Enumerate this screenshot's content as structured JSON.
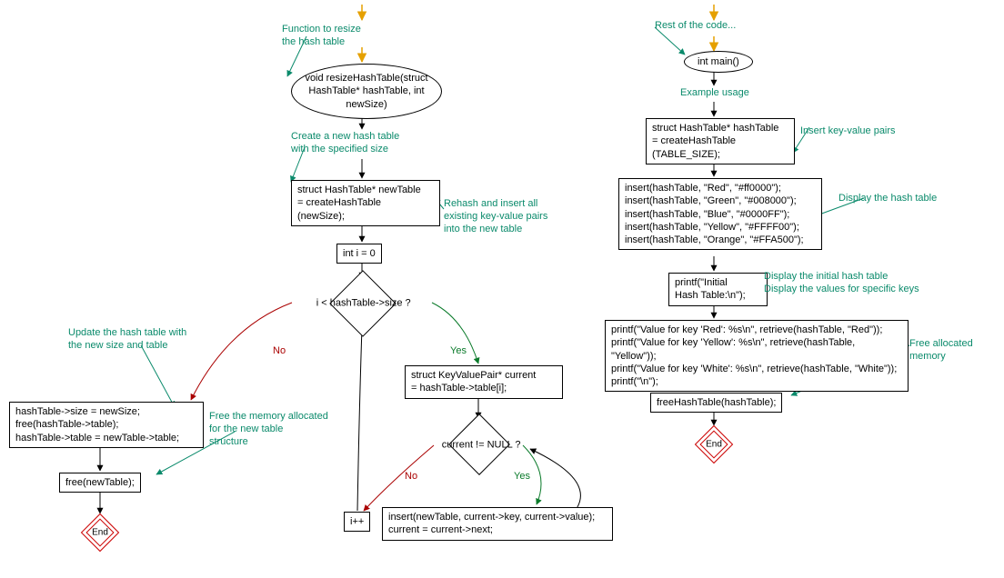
{
  "left": {
    "comment_top": "Function to resize\nthe hash table",
    "n_start": "void resizeHashTable(struct\nHashTable* hashTable, int\nnewSize)",
    "comment_create": "Create a new hash table\nwith the specified size",
    "n_create": "struct HashTable* newTable\n= createHashTable\n(newSize);",
    "comment_rehash": "Rehash and insert all\nexisting key-value pairs\ninto the new table",
    "n_init_i": "int i = 0",
    "n_cond_i": "i < hashTable->size ?",
    "no": "No",
    "yes": "Yes",
    "comment_update": "Update the hash table with\nthe new size and table",
    "n_update": "hashTable->size = newSize;\nfree(hashTable->table);\nhashTable->table = newTable->table;",
    "comment_free": "Free the memory allocated\nfor the new table\nstructure",
    "n_free": "free(newTable);",
    "end": "End",
    "n_current": "struct KeyValuePair* current\n= hashTable->table[i];",
    "n_cond_c": "current != NULL ?",
    "n_insert": "insert(newTable, current->key, current->value);\ncurrent = current->next;",
    "n_incr": "i++"
  },
  "right": {
    "comment_rest": "Rest of the code...",
    "n_main": "int main()",
    "comment_example": "Example usage",
    "n_create": "struct HashTable* hashTable\n= createHashTable\n(TABLE_SIZE);",
    "comment_insert": "Insert key-value pairs",
    "n_insert": "insert(hashTable, \"Red\", \"#ff0000\");\ninsert(hashTable, \"Green\", \"#008000\");\ninsert(hashTable, \"Blue\", \"#0000FF\");\ninsert(hashTable, \"Yellow\", \"#FFFF00\");\ninsert(hashTable, \"Orange\", \"#FFA500\");",
    "comment_display": "Display the hash table",
    "n_print_init": "printf(\"Initial\nHash Table:\\n\");",
    "comment_display_init": "Display the initial hash table",
    "comment_display_vals": "Display the values for specific keys",
    "n_print_vals": "printf(\"Value for key 'Red': %s\\n\", retrieve(hashTable, \"Red\"));\nprintf(\"Value for key 'Yellow': %s\\n\", retrieve(hashTable, \"Yellow\"));\nprintf(\"Value for key 'White': %s\\n\", retrieve(hashTable, \"White\"));\nprintf(\"\\n\");",
    "comment_free": "Free allocated memory",
    "n_free": "freeHashTable(hashTable);",
    "end": "End"
  },
  "chart_data": {
    "type": "flowchart",
    "flowcharts": [
      {
        "name": "resizeHashTable",
        "nodes": [
          {
            "id": "L1",
            "type": "start",
            "text": "void resizeHashTable(struct HashTable* hashTable, int newSize)",
            "comment": "Function to resize the hash table"
          },
          {
            "id": "L2",
            "type": "process",
            "text": "struct HashTable* newTable = createHashTable(newSize);",
            "comment": "Create a new hash table with the specified size"
          },
          {
            "id": "L3",
            "type": "process",
            "text": "int i = 0",
            "comment": "Rehash and insert all existing key-value pairs into the new table"
          },
          {
            "id": "L4",
            "type": "decision",
            "text": "i < hashTable->size ?"
          },
          {
            "id": "L5",
            "type": "process",
            "text": "struct KeyValuePair* current = hashTable->table[i];"
          },
          {
            "id": "L6",
            "type": "decision",
            "text": "current != NULL ?"
          },
          {
            "id": "L7",
            "type": "process",
            "text": "insert(newTable, current->key, current->value); current = current->next;"
          },
          {
            "id": "L8",
            "type": "process",
            "text": "i++"
          },
          {
            "id": "L9",
            "type": "process",
            "text": "hashTable->size = newSize; free(hashTable->table); hashTable->table = newTable->table;",
            "comment": "Update the hash table with the new size and table"
          },
          {
            "id": "L10",
            "type": "process",
            "text": "free(newTable);",
            "comment": "Free the memory allocated for the new table structure"
          },
          {
            "id": "L11",
            "type": "end",
            "text": "End"
          }
        ],
        "edges": [
          {
            "from": "L1",
            "to": "L2"
          },
          {
            "from": "L2",
            "to": "L3"
          },
          {
            "from": "L3",
            "to": "L4"
          },
          {
            "from": "L4",
            "to": "L5",
            "label": "Yes"
          },
          {
            "from": "L4",
            "to": "L9",
            "label": "No"
          },
          {
            "from": "L5",
            "to": "L6"
          },
          {
            "from": "L6",
            "to": "L7",
            "label": "Yes"
          },
          {
            "from": "L7",
            "to": "L6"
          },
          {
            "from": "L6",
            "to": "L8",
            "label": "No"
          },
          {
            "from": "L8",
            "to": "L4"
          },
          {
            "from": "L9",
            "to": "L10"
          },
          {
            "from": "L10",
            "to": "L11"
          }
        ]
      },
      {
        "name": "main",
        "nodes": [
          {
            "id": "R1",
            "type": "start",
            "text": "int main()",
            "comment": "Rest of the code..."
          },
          {
            "id": "R2",
            "type": "process",
            "text": "struct HashTable* hashTable = createHashTable(TABLE_SIZE);",
            "comment": "Example usage / Insert key-value pairs"
          },
          {
            "id": "R3",
            "type": "process",
            "text": "insert(hashTable, \"Red\", \"#ff0000\"); insert(hashTable, \"Green\", \"#008000\"); insert(hashTable, \"Blue\", \"#0000FF\"); insert(hashTable, \"Yellow\", \"#FFFF00\"); insert(hashTable, \"Orange\", \"#FFA500\");",
            "comment": "Display the hash table"
          },
          {
            "id": "R4",
            "type": "process",
            "text": "printf(\"Initial Hash Table:\\n\");",
            "comment": "Display the initial hash table / Display the values for specific keys"
          },
          {
            "id": "R5",
            "type": "process",
            "text": "printf(\"Value for key 'Red': %s\\n\", retrieve(hashTable, \"Red\")); printf(\"Value for key 'Yellow': %s\\n\", retrieve(hashTable, \"Yellow\")); printf(\"Value for key 'White': %s\\n\", retrieve(hashTable, \"White\")); printf(\"\\n\");",
            "comment": "Free allocated memory"
          },
          {
            "id": "R6",
            "type": "process",
            "text": "freeHashTable(hashTable);"
          },
          {
            "id": "R7",
            "type": "end",
            "text": "End"
          }
        ],
        "edges": [
          {
            "from": "R1",
            "to": "R2"
          },
          {
            "from": "R2",
            "to": "R3"
          },
          {
            "from": "R3",
            "to": "R4"
          },
          {
            "from": "R4",
            "to": "R5"
          },
          {
            "from": "R5",
            "to": "R6"
          },
          {
            "from": "R6",
            "to": "R7"
          }
        ]
      }
    ]
  }
}
